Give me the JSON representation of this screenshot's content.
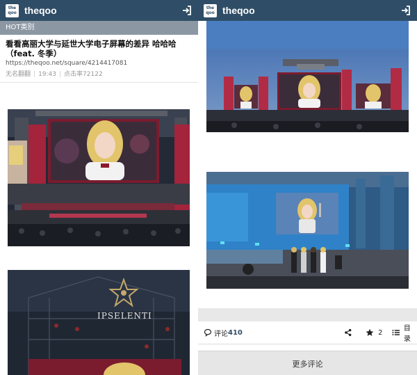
{
  "app": {
    "brand": "theqoo",
    "logo_top": "the",
    "logo_bottom": "qoo"
  },
  "left": {
    "category": "HOT类别",
    "post": {
      "title": "看看高丽大学与延世大学电子屏幕的差异 哈哈哈（feat. 冬季）",
      "url": "https://theqoo.net/square/4214417081",
      "author": "无名翻翻",
      "time": "19:43",
      "views": "点击率72122"
    },
    "stage_sign": "IPSELENTI"
  },
  "right": {
    "comments_label": "评论",
    "comments_count": "410",
    "star_count": "2",
    "list_label": "目录",
    "more_comments": "更多评论"
  },
  "icons": {
    "login": "login-icon",
    "comment": "comment-bubble-icon",
    "share": "share-icon",
    "star": "star-icon",
    "list": "list-icon"
  },
  "colors": {
    "topbar": "#2f4d66",
    "category_bar": "#8c97a4",
    "link": "#2f4d66"
  }
}
